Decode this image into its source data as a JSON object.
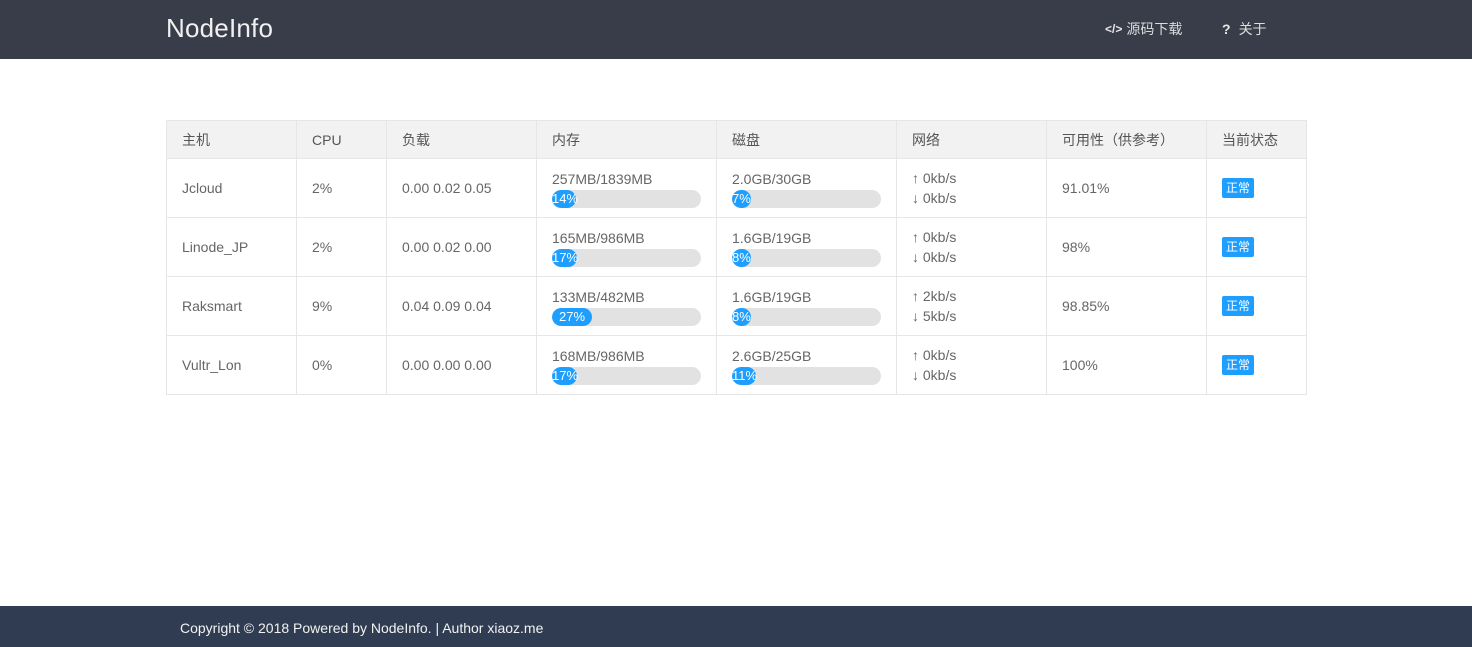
{
  "brand": "NodeInfo",
  "nav": {
    "source": {
      "icon": "</>",
      "label": "源码下载"
    },
    "about": {
      "icon": "?",
      "label": "关于"
    }
  },
  "table": {
    "headers": [
      "主机",
      "CPU",
      "负载",
      "内存",
      "磁盘",
      "网络",
      "可用性（供参考）",
      "当前状态"
    ],
    "rows": [
      {
        "host": "Jcloud",
        "cpu": "2%",
        "load": "0.00 0.02 0.05",
        "mem": "257MB/1839MB",
        "mem_pct": "14%",
        "mem_value": 0.14,
        "disk": "2.0GB/30GB",
        "disk_pct": "7%",
        "disk_value": 0.07,
        "up": "↑ 0kb/s",
        "down": "↓ 0kb/s",
        "avail": "91.01%",
        "status": "正常"
      },
      {
        "host": "Linode_JP",
        "cpu": "2%",
        "load": "0.00 0.02 0.00",
        "mem": "165MB/986MB",
        "mem_pct": "17%",
        "mem_value": 0.17,
        "disk": "1.6GB/19GB",
        "disk_pct": "8%",
        "disk_value": 0.08,
        "up": "↑ 0kb/s",
        "down": "↓ 0kb/s",
        "avail": "98%",
        "status": "正常"
      },
      {
        "host": "Raksmart",
        "cpu": "9%",
        "load": "0.04 0.09 0.04",
        "mem": "133MB/482MB",
        "mem_pct": "27%",
        "mem_value": 0.27,
        "disk": "1.6GB/19GB",
        "disk_pct": "8%",
        "disk_value": 0.08,
        "up": "↑ 2kb/s",
        "down": "↓ 5kb/s",
        "avail": "98.85%",
        "status": "正常"
      },
      {
        "host": "Vultr_Lon",
        "cpu": "0%",
        "load": "0.00 0.00 0.00",
        "mem": "168MB/986MB",
        "mem_pct": "17%",
        "mem_value": 0.17,
        "disk": "2.6GB/25GB",
        "disk_pct": "11%",
        "disk_value": 0.11,
        "up": "↑ 0kb/s",
        "down": "↓ 0kb/s",
        "avail": "100%",
        "status": "正常"
      }
    ]
  },
  "footer": "Copyright © 2018 Powered by NodeInfo. | Author xiaoz.me",
  "colors": {
    "header_bg": "#393d49",
    "footer_bg": "#2f3c52",
    "accent": "#1e9fff",
    "bar_track": "#e2e2e2"
  }
}
